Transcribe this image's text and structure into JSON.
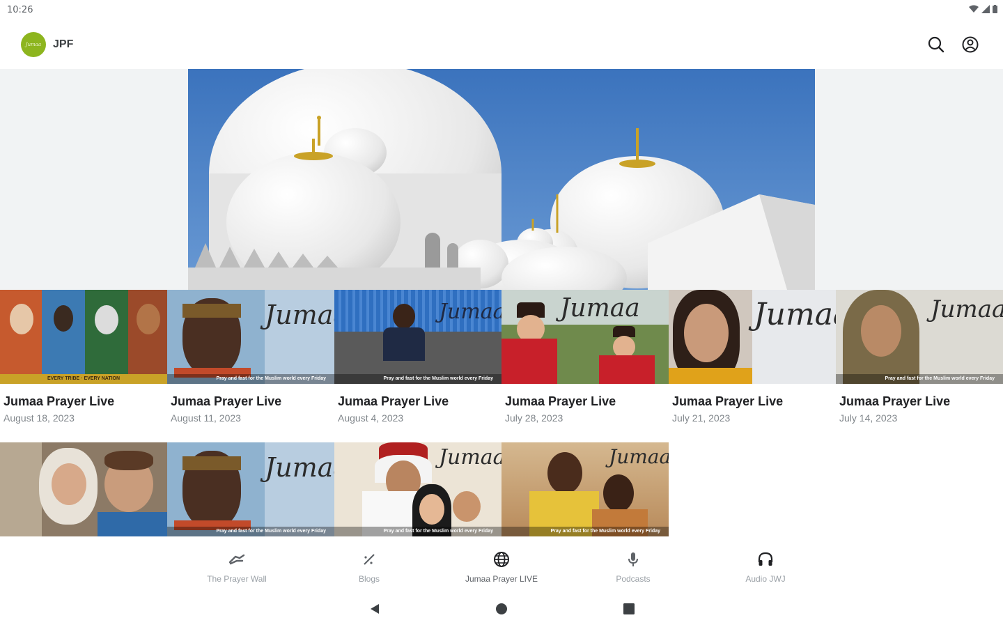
{
  "status_bar": {
    "time": "10:26"
  },
  "app_bar": {
    "title": "JPF",
    "logo_text": "Jumaa"
  },
  "hero": {
    "alt": ""
  },
  "episodes": [
    {
      "title": "Jumaa Prayer Live",
      "date": "August 18, 2023",
      "caption": "EVERY TRIBE · EVERY NATION"
    },
    {
      "title": "Jumaa Prayer Live",
      "date": "August 11, 2023",
      "caption": "Pray and fast for the Muslim world every Friday"
    },
    {
      "title": "Jumaa Prayer Live",
      "date": "August 4, 2023",
      "caption": "Pray and fast for the Muslim world every Friday"
    },
    {
      "title": "Jumaa Prayer Live",
      "date": "July 28, 2023",
      "caption": ""
    },
    {
      "title": "Jumaa Prayer Live",
      "date": "July 21, 2023",
      "caption": ""
    },
    {
      "title": "Jumaa Prayer Live",
      "date": "July 14, 2023",
      "caption": "Pray and fast for the Muslim world every Friday"
    },
    {
      "title": "",
      "date": "",
      "caption": ""
    },
    {
      "title": "",
      "date": "",
      "caption": "Pray and fast for the Muslim world every Friday"
    },
    {
      "title": "",
      "date": "",
      "caption": "Pray and fast for the Muslim world every Friday"
    },
    {
      "title": "",
      "date": "",
      "caption": "Pray and fast for the Muslim world every Friday"
    }
  ],
  "thumb_script": "Jumaa",
  "bottom_nav": [
    {
      "label": "The Prayer Wall",
      "icon": "hands-icon"
    },
    {
      "label": "Blogs",
      "icon": "blog-icon"
    },
    {
      "label": "Jumaa Prayer LIVE",
      "icon": "globe-icon"
    },
    {
      "label": "Podcasts",
      "icon": "microphone-icon"
    },
    {
      "label": "Audio JWJ",
      "icon": "headphones-icon"
    }
  ],
  "colors": {
    "brand": "#8db51e",
    "sky": "#3f78c2",
    "caption_gold": "#c9a227"
  }
}
